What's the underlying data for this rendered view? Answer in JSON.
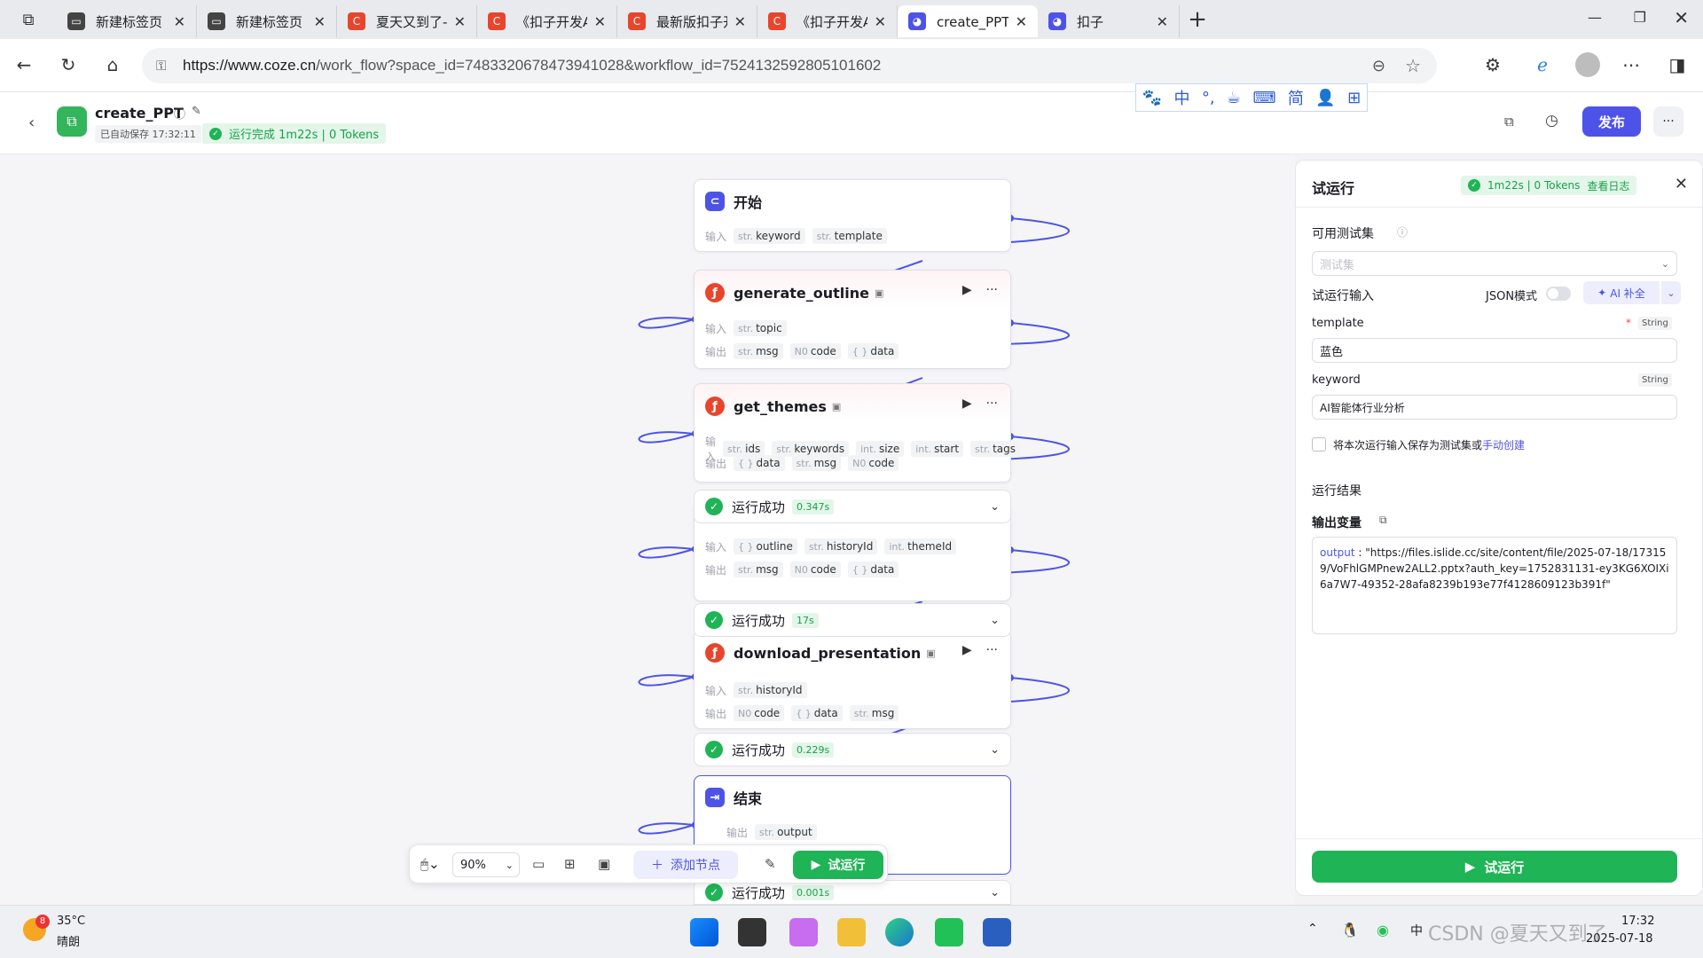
{
  "browser": {
    "tabs": [
      {
        "title": "新建标签页",
        "icon": "newtab-icon",
        "color": "#444444"
      },
      {
        "title": "新建标签页",
        "icon": "newtab-icon",
        "color": "#444444"
      },
      {
        "title": "夏天又到了-CS",
        "icon": "csdn-icon",
        "color": "#e8452c"
      },
      {
        "title": "《扣子开发AI",
        "icon": "csdn-icon",
        "color": "#e8452c"
      },
      {
        "title": "最新版扣子开发",
        "icon": "csdn-icon",
        "color": "#e8452c"
      },
      {
        "title": "《扣子开发AI",
        "icon": "csdn-icon",
        "color": "#e8452c"
      },
      {
        "title": "create_PPT - 工",
        "icon": "coze-icon",
        "color": "#4d53e8"
      },
      {
        "title": "扣子",
        "icon": "coze-icon",
        "color": "#4d53e8"
      }
    ],
    "new_tab_symbol": "+",
    "url_host": "https://www.coze.cn",
    "url_path": "/work_flow?space_id=7483320678473941028&workflow_id=7524132592805101602"
  },
  "ime_toolbar": [
    "🐾",
    "中",
    "°,",
    "☕",
    "⌨",
    "简",
    "👤",
    "⊞"
  ],
  "header": {
    "title": "create_PPT",
    "autosave": "已自动保存 17:32:11",
    "run_status": "运行完成 1m22s | 0 Tokens",
    "publish_label": "发布",
    "more_label": "···"
  },
  "nodes": {
    "start": {
      "title": "开始",
      "in_label": "输入",
      "inputs": [
        {
          "t": "str.",
          "n": "keyword"
        },
        {
          "t": "str.",
          "n": "template"
        }
      ]
    },
    "outline": {
      "title": "generate_outline",
      "in_label": "输入",
      "out_label": "输出",
      "inputs": [
        {
          "t": "str.",
          "n": "topic"
        }
      ],
      "outputs": [
        {
          "t": "str.",
          "n": "msg"
        },
        {
          "t": "N0",
          "n": "code"
        },
        {
          "t": "{ }",
          "n": "data"
        }
      ]
    },
    "themes": {
      "title": "get_themes",
      "in_label": "输入",
      "out_label": "输出",
      "inputs": [
        {
          "t": "str.",
          "n": "ids"
        },
        {
          "t": "str.",
          "n": "keywords"
        },
        {
          "t": "int.",
          "n": "size"
        },
        {
          "t": "int.",
          "n": "start"
        },
        {
          "t": "str.",
          "n": "tags"
        }
      ],
      "outputs": [
        {
          "t": "{ }",
          "n": "data"
        },
        {
          "t": "str.",
          "n": "msg"
        },
        {
          "t": "N0",
          "n": "code"
        }
      ]
    },
    "themes_result": {
      "status": "运行成功",
      "duration": "0.347s"
    },
    "gen": {
      "in_label": "输入",
      "out_label": "输出",
      "inputs": [
        {
          "t": "{ }",
          "n": "outline"
        },
        {
          "t": "str.",
          "n": "historyId"
        },
        {
          "t": "int.",
          "n": "themeId"
        }
      ],
      "outputs": [
        {
          "t": "str.",
          "n": "msg"
        },
        {
          "t": "N0",
          "n": "code"
        },
        {
          "t": "{ }",
          "n": "data"
        }
      ]
    },
    "gen_result": {
      "status": "运行成功",
      "duration": "17s"
    },
    "download": {
      "title": "download_presentation",
      "in_label": "输入",
      "out_label": "输出",
      "inputs": [
        {
          "t": "str.",
          "n": "historyId"
        }
      ],
      "outputs": [
        {
          "t": "N0",
          "n": "code"
        },
        {
          "t": "{ }",
          "n": "data"
        },
        {
          "t": "str.",
          "n": "msg"
        }
      ]
    },
    "download_result": {
      "status": "运行成功",
      "duration": "0.229s"
    },
    "end": {
      "title": "结束",
      "out_label": "输出",
      "outputs": [
        {
          "t": "str.",
          "n": "output"
        }
      ]
    },
    "end_result": {
      "status": "运行成功",
      "duration": "0.001s"
    }
  },
  "toolbar": {
    "zoom": "90%",
    "add_node": "添加节点",
    "run": "试运行"
  },
  "panel": {
    "title": "试运行",
    "summary": "1m22s | 0 Tokens",
    "view_log": "查看日志",
    "testset_label": "可用测试集",
    "testset_placeholder": "测试集",
    "run_input_label": "试运行输入",
    "json_mode": "JSON模式",
    "ai_fill": "AI 补全",
    "fields": [
      {
        "name": "template",
        "type": "String",
        "required": "*",
        "value": "蓝色"
      },
      {
        "name": "keyword",
        "type": "String",
        "required": "",
        "value": "AI智能体行业分析"
      }
    ],
    "save_text": "将本次运行输入保存为测试集或",
    "manual_create": "手动创建",
    "result_label": "运行结果",
    "output_var_label": "输出变量",
    "output_key": "output",
    "output_value": "\"https://files.islide.cc/site/content/file/2025-07-18/173159/VoFhlGMPnew2ALL2.pptx?auth_key=1752831131-ey3KG6XOIXi6a7W7-49352-28afa8239b193e77f4128609123b391f\"",
    "run_button": "试运行"
  },
  "taskbar": {
    "weather_temp": "35°C",
    "weather_desc": "晴朗",
    "weather_badge": "8",
    "time": "17:32",
    "date": "2025-07-18",
    "watermark": "CSDN @夏天又到了"
  },
  "colors": {
    "accent": "#4d53e8",
    "success": "#1fb456",
    "plugin": "#e8452c"
  }
}
